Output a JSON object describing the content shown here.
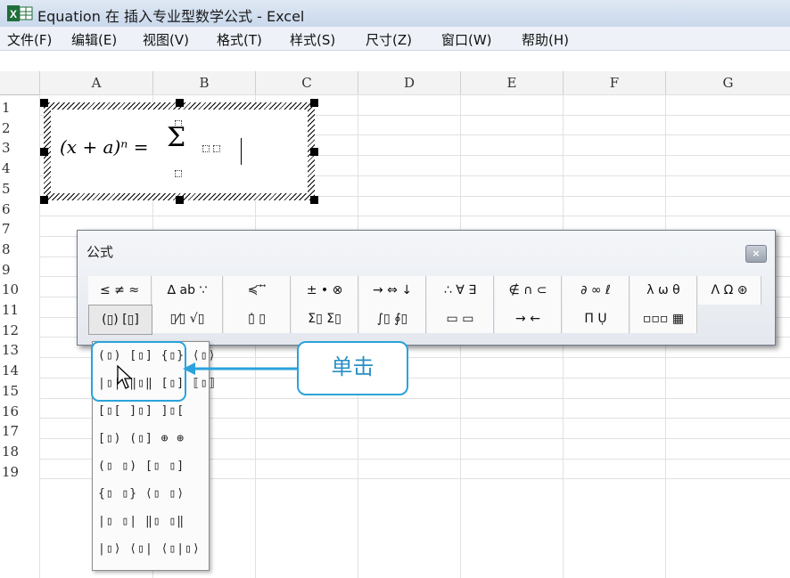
{
  "window": {
    "title": "Equation 在 插入专业型数学公式 - Excel",
    "icon": "excel-icon"
  },
  "menu": [
    "文件(F)",
    "编辑(E)",
    "视图(V)",
    "格式(T)",
    "样式(S)",
    "尺寸(Z)",
    "窗口(W)",
    "帮助(H)"
  ],
  "columns": [
    "A",
    "B",
    "C",
    "D",
    "E",
    "F",
    "G"
  ],
  "rows": [
    "1",
    "2",
    "3",
    "4",
    "5",
    "6",
    "7",
    "8",
    "9",
    "10",
    "11",
    "12",
    "13",
    "14",
    "15",
    "16",
    "17",
    "18",
    "19"
  ],
  "equation": {
    "lhs": "(x + a)ⁿ =",
    "sum_symbol": "Σ"
  },
  "toolbar": {
    "title": "公式",
    "close_label": "×",
    "row1": [
      "≤ ≠ ≈",
      "∆ ab ∵",
      "≼ ⃗ ⃗",
      "± • ⊗",
      "→ ⇔ ↓",
      "∴ ∀ ∃",
      "∉ ∩ ⊂",
      "∂ ∞ ℓ",
      "λ ω θ",
      "Λ Ω ⊛"
    ],
    "row2": [
      "(▯) [▯]",
      "▯⁄▯ √▯",
      "▯̇ ▯",
      "Σ▯ Σ▯",
      "∫▯ ∮▯",
      "▭ ▭",
      "→ ←",
      "Π̄ Ụ",
      "▫▫▫ ▦"
    ]
  },
  "palette": [
    "(▯) [▯] {▯} ⟨▯⟩",
    "|▯| ‖▯‖ [▯] ⟦▯⟧",
    "[▯[ ]▯] ]▯[",
    "[▯) (▯] ⊕ ⊕",
    "(▯  ▯) [▯  ▯]",
    "{▯  ▯} ⟨▯  ▯⟩",
    "|▯  ▯| ‖▯  ▯‖",
    "|▯⟩ ⟨▯| ⟨▯|▯⟩"
  ],
  "callout": {
    "text": "单击"
  }
}
